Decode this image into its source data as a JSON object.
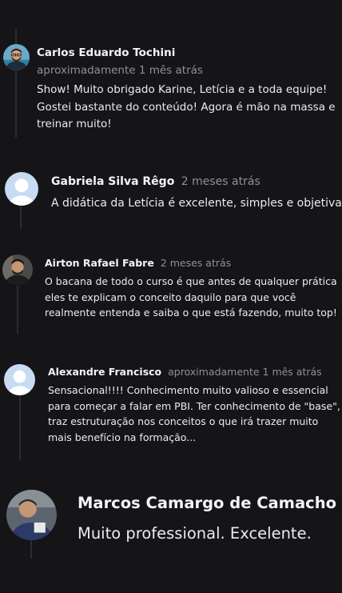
{
  "colors": {
    "background": "#151518",
    "connector": "#2c2c30",
    "name_text": "#f4f4f6",
    "time_text": "#8f8f98",
    "body_text": "#ececf0",
    "placeholder_avatar": "#c7dbf3"
  },
  "comments": [
    {
      "author": "Carlos Eduardo Tochini",
      "time": "aproximadamente 1 mês atrás",
      "avatar_icon": "user-photo-icon",
      "text": "Show! Muito obrigado Karine, Letícia e a toda equipe! Gostei bastante do conteúdo! Agora é mão na massa e treinar muito!"
    },
    {
      "author": "Gabriela Silva Rêgo",
      "time": "2 meses atrás",
      "avatar_icon": "default-user-avatar-icon",
      "text": "A didática da Letícia é excelente, simples e objetiva!"
    },
    {
      "author": "Airton Rafael Fabre",
      "time": "2 meses atrás",
      "avatar_icon": "user-photo-icon",
      "text": "O bacana de todo o curso é que antes de qualquer prática eles te explicam o conceito daquilo para que você realmente entenda e saiba o que está fazendo, muito top!"
    },
    {
      "author": "Alexandre Francisco",
      "time": "aproximadamente 1 mês atrás",
      "avatar_icon": "default-user-avatar-icon",
      "text": "Sensacional!!!! Conhecimento muito valioso e essencial para começar a falar em PBI. Ter conhecimento de \"base\", traz estruturação nos conceitos o que irá trazer muito mais benefício na formação..."
    },
    {
      "author": "Marcos Camargo de Camacho",
      "time": "",
      "avatar_icon": "user-photo-icon",
      "text": "Muito professional. Excelente."
    }
  ]
}
